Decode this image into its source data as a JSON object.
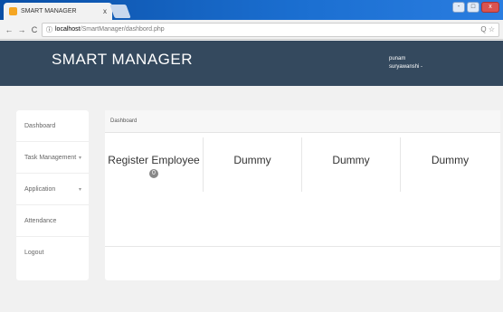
{
  "browser": {
    "tab_title": "SMART MANAGER",
    "tab_close": "x",
    "back_icon": "←",
    "forward_icon": "→",
    "reload_icon": "C",
    "info_icon": "ⓘ",
    "url_host": "localhost",
    "url_path": "/SmartManager/dashbord.php",
    "url_right": "Q ☆",
    "window_buttons": [
      "-",
      "□",
      "x"
    ]
  },
  "header": {
    "brand": "SMART MANAGER",
    "user_line1": "punam",
    "user_line2": "suryawanshi -"
  },
  "sidebar": {
    "items": [
      {
        "label": "Dashboard",
        "chevron": ""
      },
      {
        "label": "Task Management",
        "chevron": "▾"
      },
      {
        "label": "Application",
        "chevron": "▾"
      },
      {
        "label": "Attendance",
        "chevron": ""
      },
      {
        "label": "Logout",
        "chevron": ""
      }
    ]
  },
  "main": {
    "breadcrumb": "Dashboard",
    "cards": [
      {
        "label": "Register Employee",
        "badge": "0"
      },
      {
        "label": "Dummy"
      },
      {
        "label": "Dummy"
      },
      {
        "label": "Dummy"
      }
    ]
  }
}
